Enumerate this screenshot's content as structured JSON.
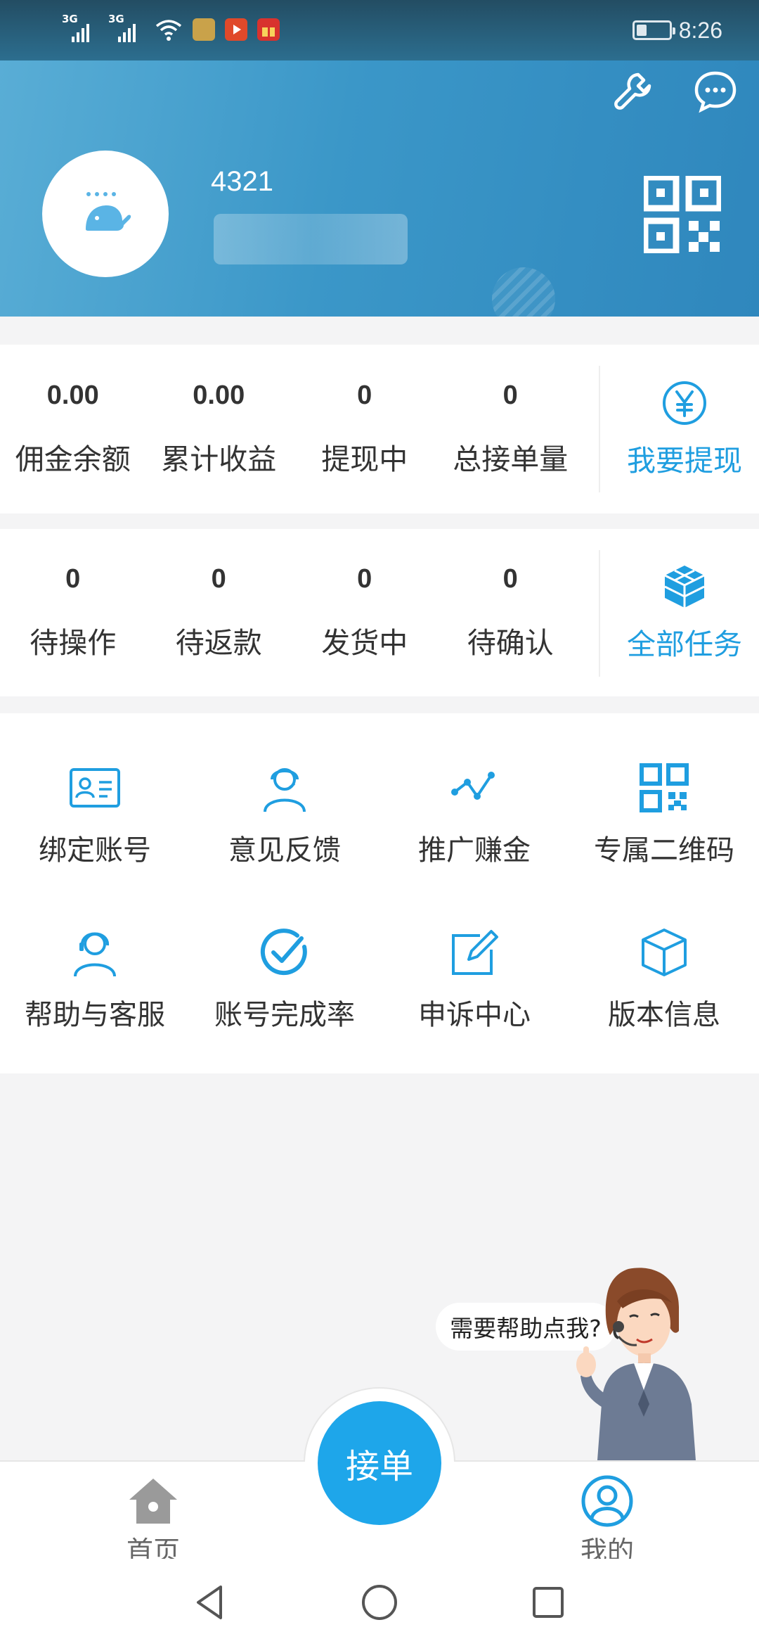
{
  "status_bar": {
    "sim1_label": "3G",
    "sim2_label": "3G",
    "time": "8:26"
  },
  "profile": {
    "username": "4321"
  },
  "stats_card": {
    "items": [
      {
        "value": "0.00",
        "label": "佣金余额"
      },
      {
        "value": "0.00",
        "label": "累计收益"
      },
      {
        "value": "0",
        "label": "提现中"
      },
      {
        "value": "0",
        "label": "总接单量"
      }
    ],
    "action_label": "我要提现"
  },
  "task_card": {
    "items": [
      {
        "value": "0",
        "label": "待操作"
      },
      {
        "value": "0",
        "label": "待返款"
      },
      {
        "value": "0",
        "label": "发货中"
      },
      {
        "value": "0",
        "label": "待确认"
      }
    ],
    "action_label": "全部任务"
  },
  "menu": {
    "items": [
      {
        "label": "绑定账号",
        "icon": "id-card-icon"
      },
      {
        "label": "意见反馈",
        "icon": "headset-person-icon"
      },
      {
        "label": "推广赚金",
        "icon": "share-graph-icon"
      },
      {
        "label": "专属二维码",
        "icon": "qr-code-icon"
      },
      {
        "label": "帮助与客服",
        "icon": "support-agent-icon"
      },
      {
        "label": "账号完成率",
        "icon": "check-circle-icon"
      },
      {
        "label": "申诉中心",
        "icon": "edit-icon"
      },
      {
        "label": "版本信息",
        "icon": "box-icon"
      }
    ]
  },
  "helper": {
    "bubble_text": "需要帮助点我?"
  },
  "tabbar": {
    "home_label": "首页",
    "center_label": "接单",
    "mine_label": "我的"
  },
  "colors": {
    "accent": "#1ea6ea",
    "action_text": "#1f9ee0",
    "header_start": "#5aaed6",
    "header_end": "#2f87bd"
  }
}
